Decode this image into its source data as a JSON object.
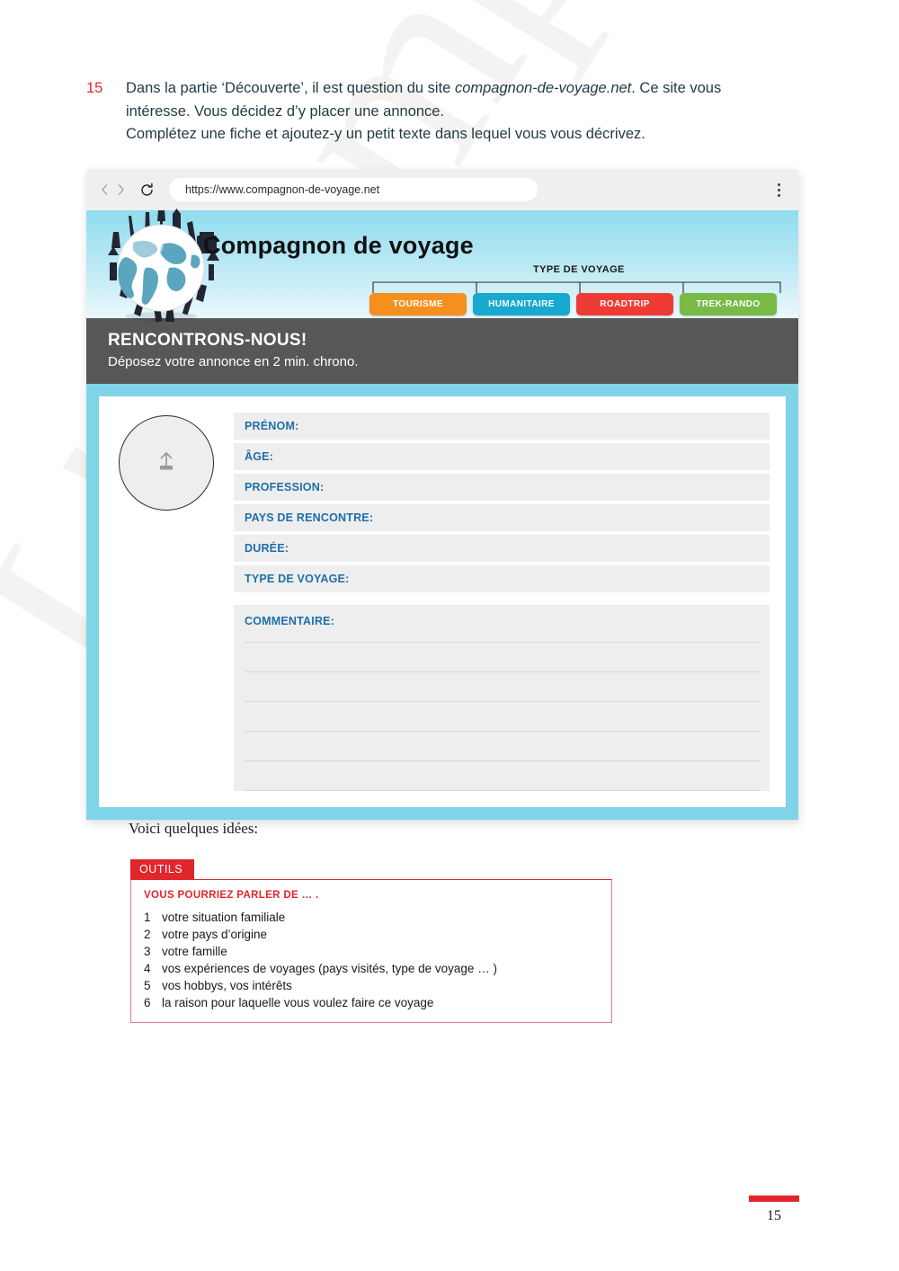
{
  "watermark": {
    "text": "L'exemplaar"
  },
  "exercise": {
    "number": "15",
    "line1_a": "Dans la partie ‘Découverte’, il est question du site ",
    "line1_em": "compagnon-de-voyage.net",
    "line1_b": ". Ce site vous intéresse. Vous décidez d’y placer une annonce.",
    "line2": "Complétez une fiche et ajoutez-y un petit texte dans lequel vous vous décrivez."
  },
  "browser": {
    "url": "https://www.compagnon-de-voyage.net",
    "back_icon": "chevron-left-icon",
    "forward_icon": "chevron-right-icon",
    "reload_icon": "reload-icon",
    "menu_icon": "kebab-menu-icon"
  },
  "site": {
    "logo_icon": "globe-landmarks-icon",
    "brand": "Compagnon de voyage",
    "nav_group_label": "TYPE DE VOYAGE",
    "nav_buttons": [
      {
        "label": "TOURISME",
        "color": "#f5901f"
      },
      {
        "label": "HUMANITAIRE",
        "color": "#17a9cf"
      },
      {
        "label": "ROADTRIP",
        "color": "#ee3b33"
      },
      {
        "label": "TREK-RANDO",
        "color": "#78ba45"
      }
    ],
    "band_title": "RENCONTRONS-NOUS!",
    "band_subtitle": "Déposez votre annonce en 2 min. chrono.",
    "band_bg": "#575757",
    "frame_color": "#7fd4e8"
  },
  "form": {
    "avatar_icon": "upload-icon",
    "fields": [
      {
        "label": "PRÉNOM:",
        "value": ""
      },
      {
        "label": "ÂGE:",
        "value": ""
      },
      {
        "label": "PROFESSION:",
        "value": ""
      },
      {
        "label": "PAYS DE RENCONTRE:",
        "value": ""
      },
      {
        "label": "DURÉE:",
        "value": ""
      },
      {
        "label": "TYPE DE VOYAGE:",
        "value": ""
      }
    ],
    "comment_label": "COMMENTAIRE:",
    "comment_lines": 5,
    "label_color": "#1e6fa8"
  },
  "idees": {
    "text": "Voici quelques idées:"
  },
  "outils": {
    "tab": "OUTILS",
    "heading": "VOUS POURRIEZ PARLER DE … .",
    "accent": "#e1262c",
    "items": [
      {
        "num": "1",
        "text": "votre situation familiale"
      },
      {
        "num": "2",
        "text": "votre pays d’origine"
      },
      {
        "num": "3",
        "text": "votre famille"
      },
      {
        "num": "4",
        "text": "vos expériences de voyages (pays visités, type de voyage … )"
      },
      {
        "num": "5",
        "text": "vos hobbys, vos intérêts"
      },
      {
        "num": "6",
        "text": "la raison pour laquelle vous voulez faire ce voyage"
      }
    ]
  },
  "footer": {
    "page_number": "15"
  }
}
